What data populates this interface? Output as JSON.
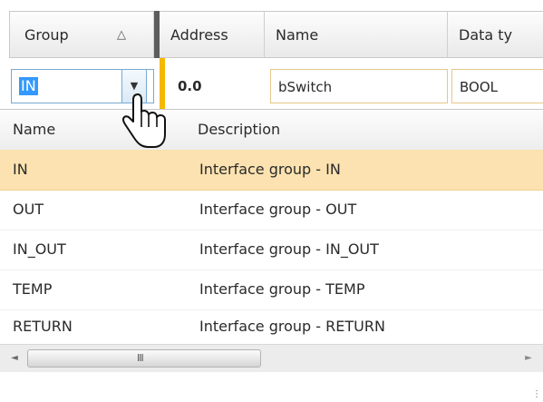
{
  "header": {
    "group": "Group",
    "sort_arrow": "△",
    "address": "Address",
    "name": "Name",
    "data_type": "Data ty"
  },
  "edit_row": {
    "group_value": "IN",
    "address": "0.0",
    "name": "bSwitch",
    "data_type": "BOOL"
  },
  "dropdown": {
    "col_name": "Name",
    "col_description": "Description",
    "rows": [
      {
        "name": "IN",
        "description": "Interface group - IN",
        "selected": true
      },
      {
        "name": "OUT",
        "description": "Interface group - OUT",
        "selected": false
      },
      {
        "name": "IN_OUT",
        "description": "Interface group - IN_OUT",
        "selected": false
      },
      {
        "name": "TEMP",
        "description": "Interface group - TEMP",
        "selected": false
      },
      {
        "name": "RETURN",
        "description": "Interface group - RETURN",
        "selected": false
      }
    ]
  },
  "scrollbar": {
    "left_arrow": "◄",
    "grip": "III",
    "right_arrow": "►"
  },
  "colors": {
    "selection": "#fbe2b0",
    "accent": "#f5b800",
    "text_highlight": "#3399ff"
  },
  "icons": {
    "cursor": "hand-pointer-icon",
    "dropdown": "chevron-down-icon"
  }
}
